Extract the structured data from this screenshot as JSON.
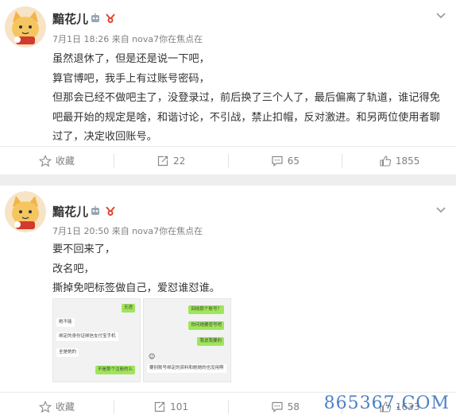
{
  "posts": [
    {
      "user_name": "黯花儿",
      "meta": "7月1日 18:26 来自 nova7你在焦点在",
      "lines": [
        "虽然退休了，但是还是说一下吧，",
        "算官博吧，我手上有过账号密码，",
        "但那会已经不做吧主了，没登录过，前后换了三个人了，最后偏离了轨道，谁记得免吧最开始的规定是啥，和谐讨论，不引战，禁止扣帽，反对激进。和另两位使用者聊过了，决定收回账号。"
      ],
      "actions": {
        "favorite": "收藏",
        "repost": "22",
        "comment": "65",
        "like": "1855"
      }
    },
    {
      "user_name": "黯花儿",
      "meta": "7月1日 20:50 来自 nova7你在焦点在",
      "lines": [
        "要不回来了，",
        "改名吧，",
        "撕掉免吧标签做自己，爱怼谁怼谁。"
      ],
      "images": [
        {
          "bubbles": [
            "无语",
            "她不能",
            "绑定的身份证绑信支付宝手机",
            "全是她的",
            "不是那个注册的么"
          ]
        },
        {
          "bubbles": [
            "回收那个账号？",
            "你问她要密号吧",
            "我说我要的",
            "要别账号绑定的资料和她她的也没用啊"
          ]
        }
      ],
      "actions": {
        "favorite": "收藏",
        "repost": "101",
        "comment": "58",
        "like": "1633"
      }
    }
  ],
  "watermark": "865367.COM",
  "colors": {
    "accent": "#ff8200",
    "text": "#333333",
    "meta": "#808080",
    "link": "#2e6ab8"
  }
}
